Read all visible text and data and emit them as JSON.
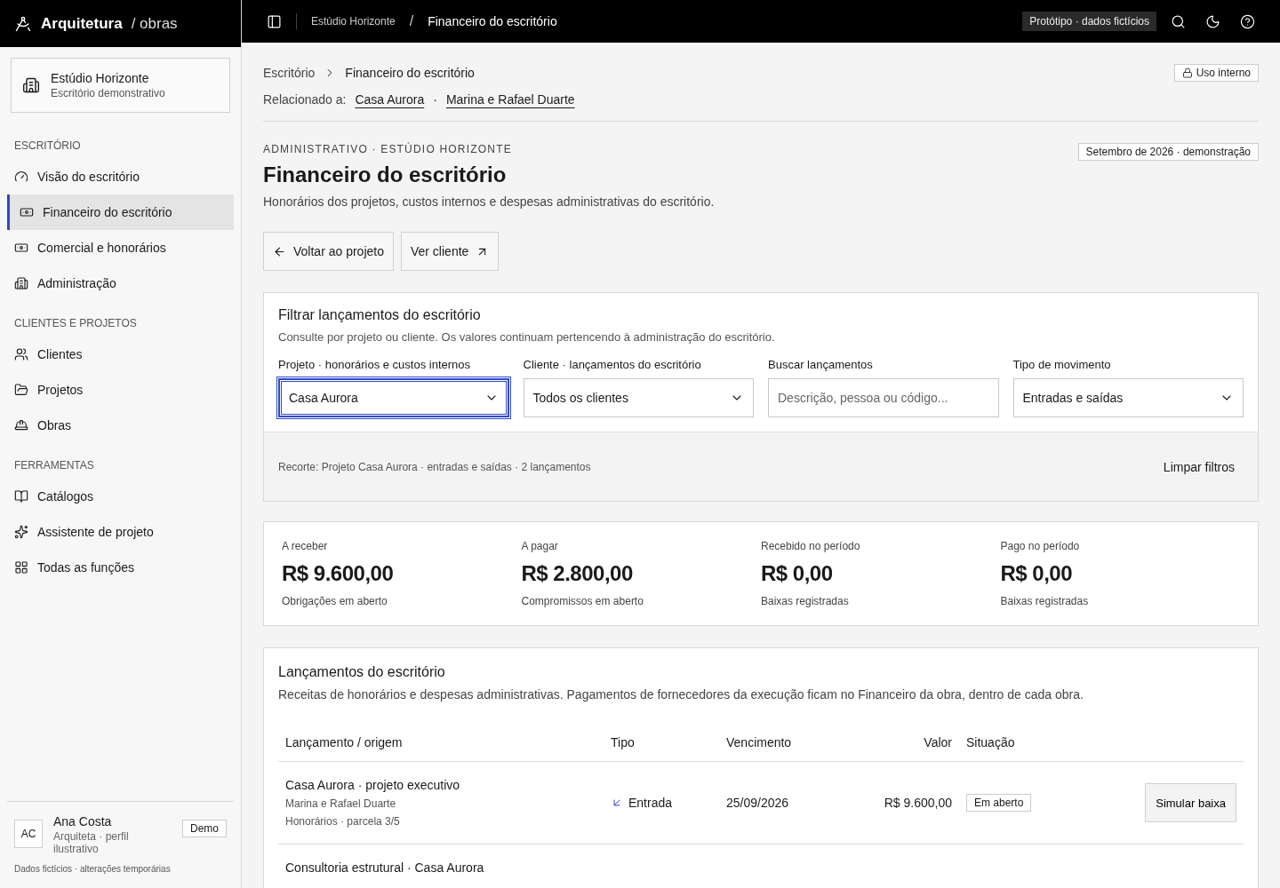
{
  "brand": {
    "name": "Arquitetura",
    "suffix": "/ obras"
  },
  "org": {
    "name": "Estúdio Horizonte",
    "subtitle": "Escritório demonstrativo"
  },
  "nav_sections": [
    {
      "heading": "ESCRITÓRIO",
      "items": [
        {
          "label": "Visão do escritório",
          "selected": false
        },
        {
          "label": "Financeiro do escritório",
          "selected": true
        },
        {
          "label": "Comercial e honorários",
          "selected": false
        },
        {
          "label": "Administração",
          "selected": false
        }
      ]
    },
    {
      "heading": "CLIENTES E PROJETOS",
      "items": [
        {
          "label": "Clientes",
          "selected": false
        },
        {
          "label": "Projetos",
          "selected": false
        },
        {
          "label": "Obras",
          "selected": false
        }
      ]
    },
    {
      "heading": "FERRAMENTAS",
      "items": [
        {
          "label": "Catálogos",
          "selected": false
        },
        {
          "label": "Assistente de projeto",
          "selected": false
        },
        {
          "label": "Todas as funções",
          "selected": false
        }
      ]
    }
  ],
  "user": {
    "initials": "AC",
    "name": "Ana Costa",
    "role": "Arquiteta · perfil ilustrativo",
    "badge": "Demo"
  },
  "footer_note": "Dados fictícios · alterações temporárias",
  "topbar": {
    "separator": "/",
    "crumbs": [
      "Estúdio Horizonte",
      "Financeiro do escritório"
    ],
    "badge": "Protótipo · dados fictícios"
  },
  "breadcrumb": [
    "Escritório",
    "Financeiro do escritório"
  ],
  "access_badge": "Uso interno",
  "related": {
    "label": "Relacionado a:",
    "separator": "·",
    "links": [
      "Casa Aurora",
      "Marina e Rafael Duarte"
    ]
  },
  "header": {
    "eyebrow": "ADMINISTRATIVO · ESTÚDIO HORIZONTE",
    "title": "Financeiro do escritório",
    "description": "Honorários dos projetos, custos internos e despesas administrativas do escritório.",
    "period": "Setembro de 2026 · demonstração"
  },
  "actions": [
    {
      "label": "Voltar ao projeto",
      "kind": "back"
    },
    {
      "label": "Ver cliente",
      "kind": "external"
    }
  ],
  "filters": {
    "title": "Filtrar lançamentos do escritório",
    "description": "Consulte por projeto ou cliente. Os valores continuam pertencendo à administração do escritório.",
    "fields": [
      {
        "label": "Projeto · honorários e custos internos",
        "kind": "select",
        "value": "Casa Aurora",
        "focused": true
      },
      {
        "label": "Cliente · lançamentos do escritório",
        "kind": "select",
        "value": "Todos os clientes",
        "focused": false
      },
      {
        "label": "Buscar lançamentos",
        "kind": "search",
        "placeholder": "Descrição, pessoa ou código...",
        "focused": false
      },
      {
        "label": "Tipo de movimento",
        "kind": "select",
        "value": "Entradas e saídas",
        "focused": false
      }
    ],
    "summary": "Recorte: Projeto Casa Aurora · entradas e saídas · 2 lançamentos",
    "clear": "Limpar filtros"
  },
  "metrics": [
    {
      "label": "A receber",
      "value": "R$ 9.600,00",
      "note": "Obrigações em aberto"
    },
    {
      "label": "A pagar",
      "value": "R$ 2.800,00",
      "note": "Compromissos em aberto"
    },
    {
      "label": "Recebido no período",
      "value": "R$ 0,00",
      "note": "Baixas registradas"
    },
    {
      "label": "Pago no período",
      "value": "R$ 0,00",
      "note": "Baixas registradas"
    }
  ],
  "entries": {
    "title": "Lançamentos do escritório",
    "description": "Receitas de honorários e despesas administrativas. Pagamentos de fornecedores da execução ficam no Financeiro da obra, dentro de cada obra.",
    "columns": [
      "Lançamento / origem",
      "Tipo",
      "Vencimento",
      "Valor",
      "Situação"
    ],
    "rows": [
      {
        "title": "Casa Aurora · projeto executivo",
        "party": "Marina e Rafael Duarte",
        "detail": "Honorários · parcela 3/5",
        "type": "Entrada",
        "kind": "in",
        "due": "25/09/2026",
        "amount": "R$ 9.600,00",
        "status": "Em aberto",
        "action": "Simular baixa"
      },
      {
        "title": "Consultoria estrutural · Casa Aurora"
      }
    ]
  }
}
